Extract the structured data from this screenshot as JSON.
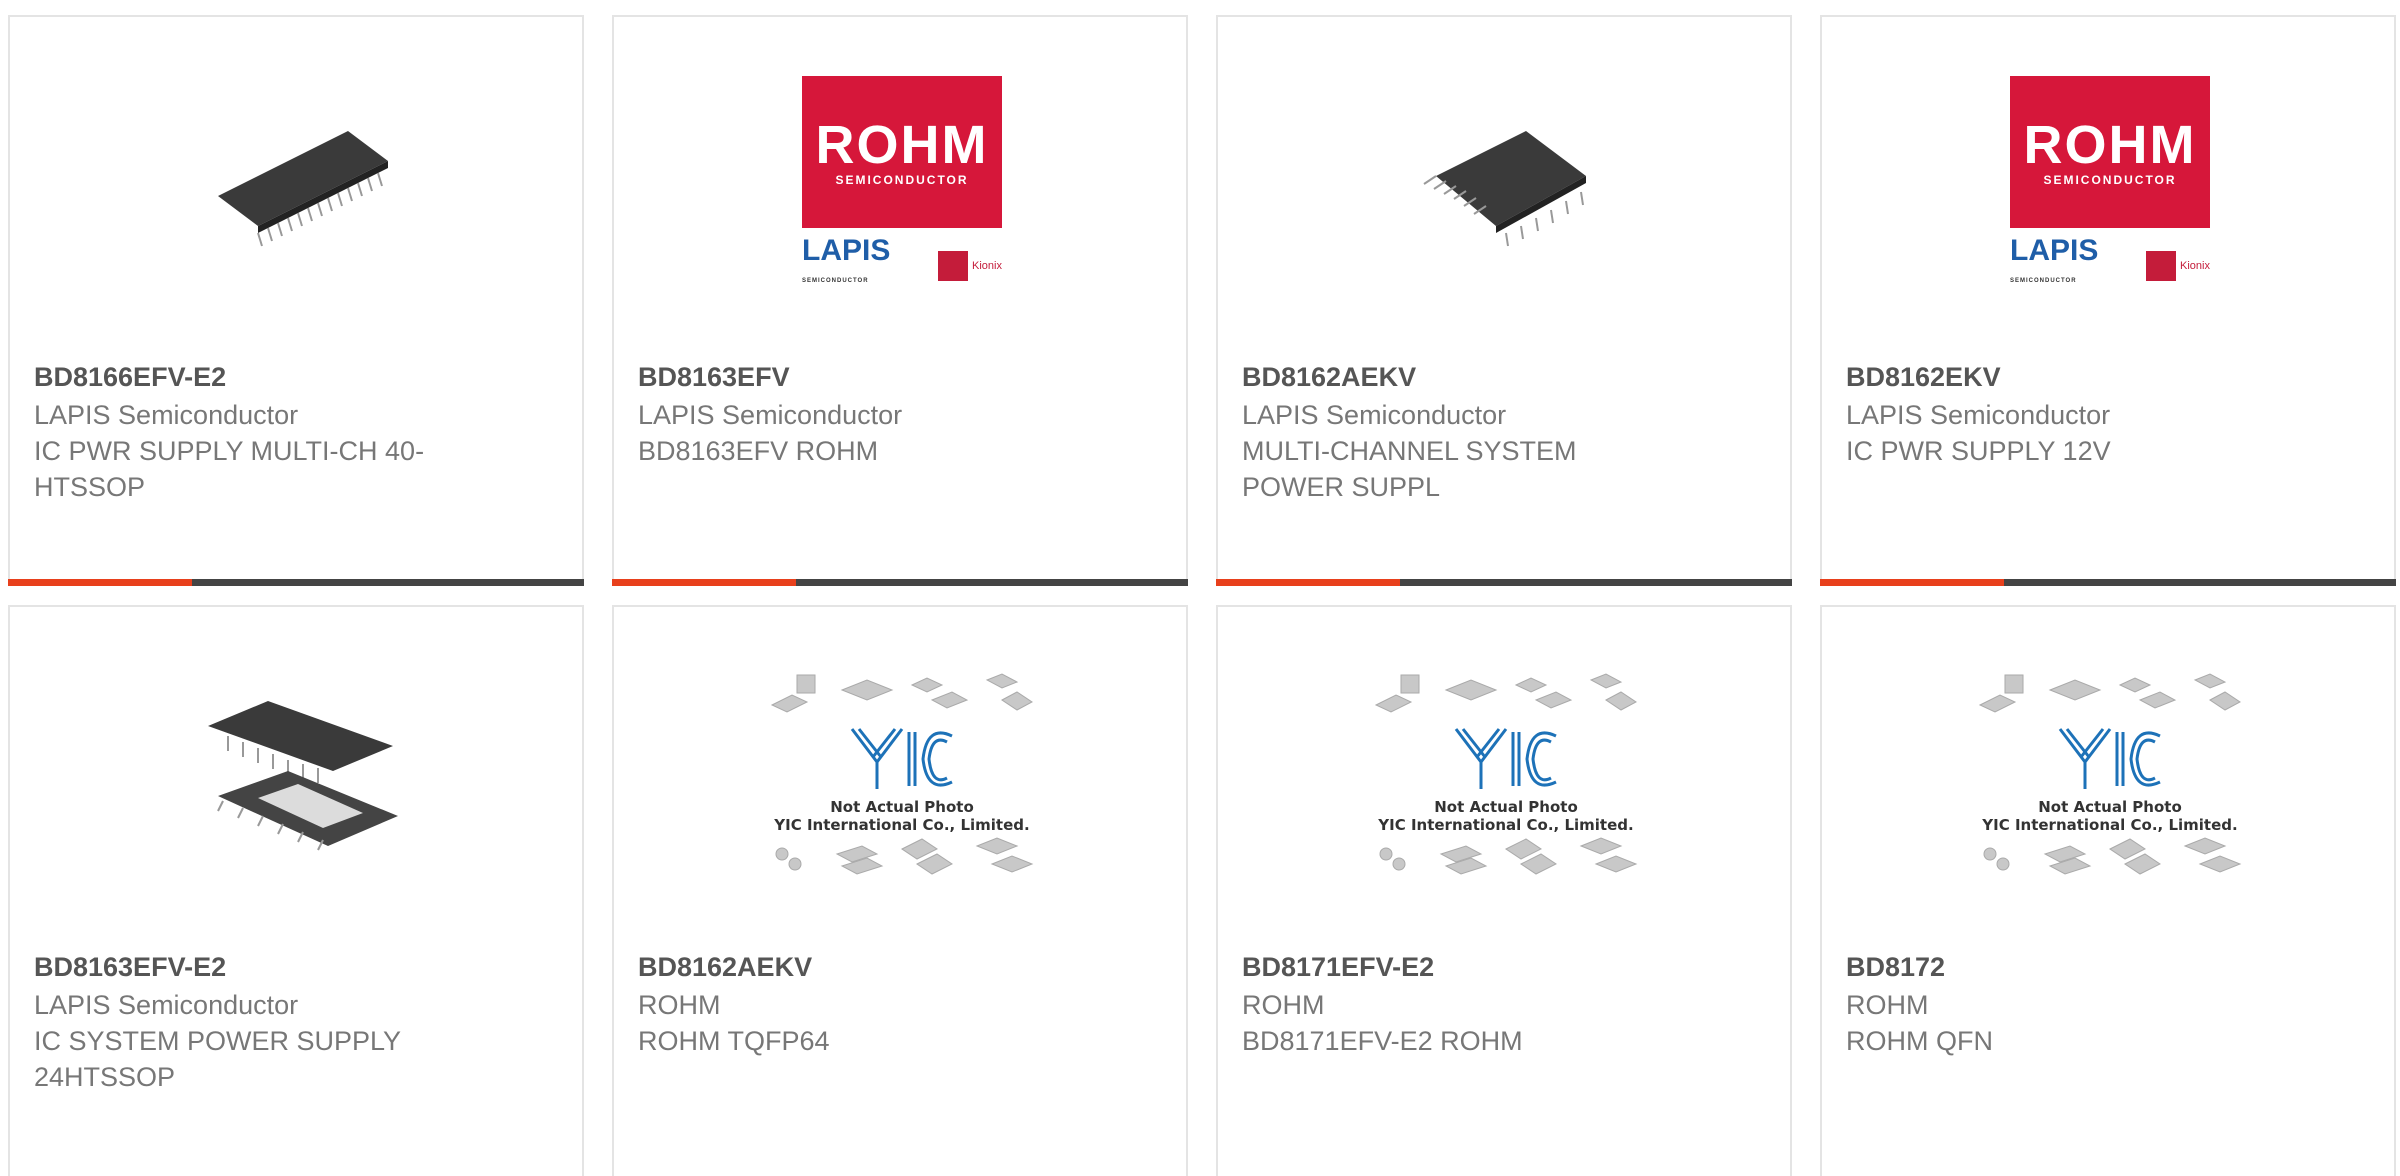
{
  "products": [
    {
      "part": "BD8166EFV-E2",
      "manufacturer": "LAPIS Semiconductor",
      "description": "IC PWR SUPPLY MULTI-CH 40-HTSSOP",
      "image": "chip-ssop-icon"
    },
    {
      "part": "BD8163EFV",
      "manufacturer": "LAPIS Semiconductor",
      "description": "BD8163EFV ROHM",
      "image": "rohm-logo"
    },
    {
      "part": "BD8162AEKV",
      "manufacturer": "LAPIS Semiconductor",
      "description": "MULTI-CHANNEL SYSTEM POWER SUPPL",
      "image": "chip-qfp-icon"
    },
    {
      "part": "BD8162EKV",
      "manufacturer": "LAPIS Semiconductor",
      "description": "IC PWR SUPPLY 12V",
      "image": "rohm-logo"
    },
    {
      "part": "BD8163EFV-E2",
      "manufacturer": "LAPIS Semiconductor",
      "description": "IC SYSTEM POWER SUPPLY 24HTSSOP",
      "image": "chip-htssop-icon"
    },
    {
      "part": "BD8162AEKV",
      "manufacturer": "ROHM",
      "description": "ROHM TQFP64",
      "image": "yic-placeholder"
    },
    {
      "part": "BD8171EFV-E2",
      "manufacturer": "ROHM",
      "description": "BD8171EFV-E2 ROHM",
      "image": "yic-placeholder"
    },
    {
      "part": "BD8172",
      "manufacturer": "ROHM",
      "description": "ROHM QFN",
      "image": "yic-placeholder"
    }
  ],
  "logos": {
    "rohm_big": "ROHM",
    "rohm_small": "SEMICONDUCTOR",
    "lapis": "LAPIS",
    "lapis_small": "SEMICONDUCTOR",
    "kionix": "Kionix"
  },
  "placeholder": {
    "line1": "Not Actual Photo",
    "line2": "YIC International Co., Limited."
  },
  "colors": {
    "accent": "#e8401c",
    "bar": "#444444",
    "rohm_red": "#d6173a",
    "lapis_blue": "#1f5ea8",
    "yic_blue": "#1d72b8"
  }
}
